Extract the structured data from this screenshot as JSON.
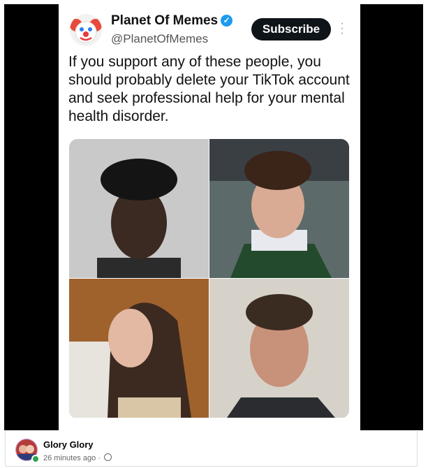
{
  "post": {
    "author": "Planet Of Memes",
    "handle": "@PlanetOfMemes",
    "subscribe_label": "Subscribe",
    "text": "If you support any of these people, you should probably delete your TikTok account and seek professional help for your mental health disorder.",
    "photos": [
      "photo-top-left",
      "photo-top-right",
      "photo-bottom-left",
      "photo-bottom-right"
    ]
  },
  "footer": {
    "poster_name": "Glory Glory",
    "time": "26 minutes ago",
    "separator": "·"
  },
  "colors": {
    "verified": "#1d9bf0",
    "subscribe_bg": "#0f1419",
    "online": "#31a24c"
  }
}
